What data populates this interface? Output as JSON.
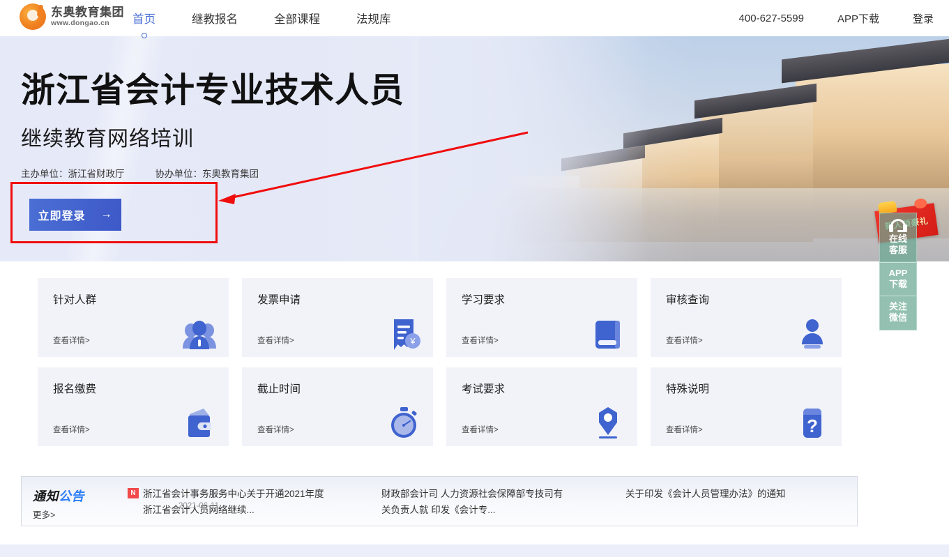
{
  "header": {
    "logo": {
      "name_cn": "东奥教育集团",
      "url": "www.dongao.cn"
    },
    "nav": [
      {
        "label": "首页",
        "active": true
      },
      {
        "label": "继教报名",
        "active": false
      },
      {
        "label": "全部课程",
        "active": false
      },
      {
        "label": "法规库",
        "active": false
      }
    ],
    "right": [
      {
        "label": "400-627-5599"
      },
      {
        "label": "APP下载"
      },
      {
        "label": "登录"
      }
    ]
  },
  "hero": {
    "title": "浙江省会计专业技术人员",
    "subtitle": "继续教育网络培训",
    "organizer": "主办单位：浙江省财政厅",
    "coorganizer": "协办单位：东奥教育集团",
    "login_button": "立即登录",
    "login_arrow": "→",
    "gift_ribbon": "新人领豪礼"
  },
  "side_widget": [
    {
      "label_line1": "在线",
      "label_line2": "客服",
      "icon": "headset-icon"
    },
    {
      "label_line1": "APP",
      "label_line2": "下载",
      "icon": ""
    },
    {
      "label_line1": "关注",
      "label_line2": "微信",
      "icon": ""
    }
  ],
  "cards": {
    "link_label": "查看详情>",
    "items": [
      {
        "title": "针对人群",
        "icon": "people-group-icon"
      },
      {
        "title": "发票申请",
        "icon": "invoice-yuan-icon"
      },
      {
        "title": "学习要求",
        "icon": "book-icon"
      },
      {
        "title": "审核查询",
        "icon": "stamp-person-icon"
      },
      {
        "title": "报名缴费",
        "icon": "wallet-icon"
      },
      {
        "title": "截止时间",
        "icon": "stopwatch-icon"
      },
      {
        "title": "考试要求",
        "icon": "pen-nib-icon"
      },
      {
        "title": "特殊说明",
        "icon": "question-mark-icon"
      }
    ]
  },
  "notice": {
    "title_part1": "通知",
    "title_part2": "公告",
    "more": "更多>",
    "badge": "N",
    "items": [
      {
        "line1": "浙江省会计事务服务中心关于开通2021年度",
        "line2": "浙江省会计人员网络继续...",
        "date": "2021-06-11"
      },
      {
        "line1": "财政部会计司 人力资源社会保障部专技司有",
        "line2": "关负责人就 印发《会计专...",
        "date": ""
      },
      {
        "line1": "关于印发《会计人员管理办法》的通知",
        "line2": "",
        "date": ""
      }
    ]
  },
  "annotation": {
    "box_color": "#f00d0d",
    "arrow_color": "#f00d0d"
  }
}
